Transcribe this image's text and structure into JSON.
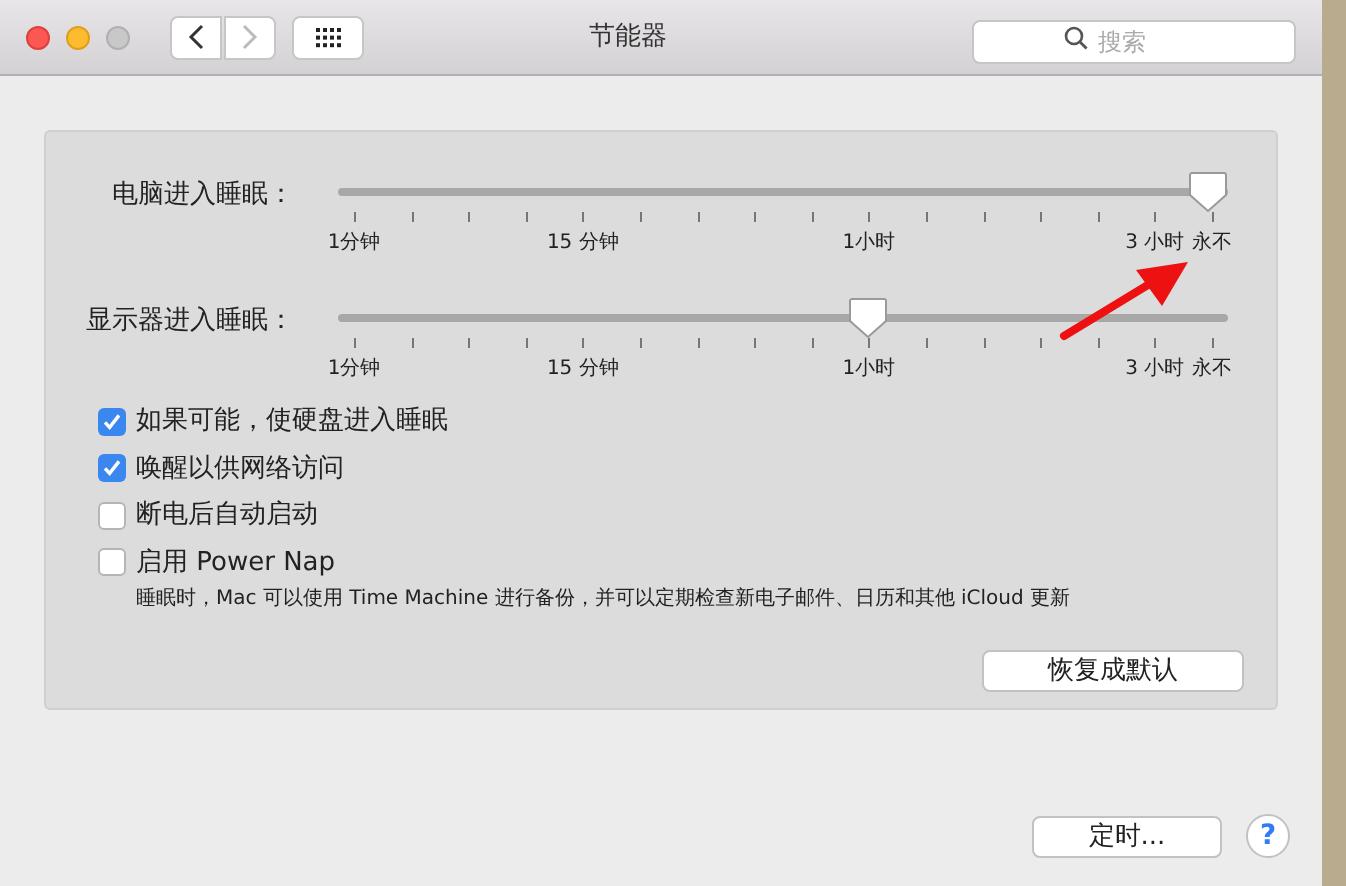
{
  "window": {
    "title": "节能器"
  },
  "toolbar": {
    "search": {
      "placeholder": "搜索"
    }
  },
  "sliders": [
    {
      "label": "电脑进入睡眠：",
      "level": 1,
      "tick_labels": [
        "1分钟",
        "15 分钟",
        "1小时",
        "3 小时",
        "永不"
      ]
    },
    {
      "label": "显示器进入睡眠：",
      "level": 0.6,
      "tick_labels": [
        "1分钟",
        "15 分钟",
        "1小时",
        "3 小时",
        "永不"
      ]
    }
  ],
  "options": [
    {
      "label": "如果可能，使硬盘进入睡眠",
      "checked": true
    },
    {
      "label": "唤醒以供网络访问",
      "checked": true
    },
    {
      "label": "断电后自动启动",
      "checked": false
    },
    {
      "label": "启用 Power Nap",
      "checked": false,
      "description": "睡眠时，Mac 可以使用 Time Machine 进行备份，并可以定期检查新电子邮件、日历和其他 iCloud 更新"
    }
  ],
  "buttons": {
    "restore": "恢复成默认",
    "schedule": "定时...",
    "help": "?"
  }
}
